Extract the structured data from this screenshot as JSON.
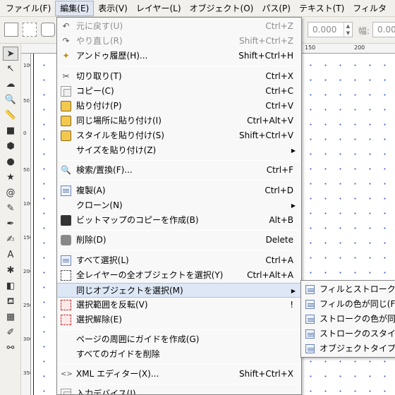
{
  "menubar": {
    "items": [
      {
        "label": "ファイル(F)"
      },
      {
        "label": "編集(E)"
      },
      {
        "label": "表示(V)"
      },
      {
        "label": "レイヤー(L)"
      },
      {
        "label": "オブジェクト(O)"
      },
      {
        "label": "パス(P)"
      },
      {
        "label": "テキスト(T)"
      },
      {
        "label": "フィルタ"
      }
    ]
  },
  "toolbar": {
    "x_value": "0.000",
    "w_label": "幅:",
    "w_value": "0.00"
  },
  "ruler": {
    "top_ticks": [
      "150",
      "200"
    ],
    "left_ticks": [
      "100",
      "50",
      "0",
      "50",
      "100",
      "150",
      "200",
      "250",
      "300",
      "350"
    ]
  },
  "edit_menu": {
    "undo": {
      "label": "元に戻す(U)",
      "shortcut": "Ctrl+Z"
    },
    "redo": {
      "label": "やり直し(R)",
      "shortcut": "Shift+Ctrl+Z"
    },
    "history": {
      "label": "アンドゥ履歴(H)...",
      "shortcut": "Shift+Ctrl+H"
    },
    "cut": {
      "label": "切り取り(T)",
      "shortcut": "Ctrl+X"
    },
    "copy": {
      "label": "コピー(C)",
      "shortcut": "Ctrl+C"
    },
    "paste": {
      "label": "貼り付け(P)",
      "shortcut": "Ctrl+V"
    },
    "paste_in_place": {
      "label": "同じ場所に貼り付け(I)",
      "shortcut": "Ctrl+Alt+V"
    },
    "paste_style": {
      "label": "スタイルを貼り付け(S)",
      "shortcut": "Shift+Ctrl+V"
    },
    "paste_size": {
      "label": "サイズを貼り付け(Z)"
    },
    "find_replace": {
      "label": "検索/置換(F)...",
      "shortcut": "Ctrl+F"
    },
    "duplicate": {
      "label": "複製(A)",
      "shortcut": "Ctrl+D"
    },
    "clone": {
      "label": "クローン(N)"
    },
    "make_bitmap": {
      "label": "ビットマップのコピーを作成(B)",
      "shortcut": "Alt+B"
    },
    "delete": {
      "label": "削除(D)",
      "shortcut": "Delete"
    },
    "select_all": {
      "label": "すべて選択(L)",
      "shortcut": "Ctrl+A"
    },
    "select_all_layers": {
      "label": "全レイヤーの全オブジェクトを選択(Y)",
      "shortcut": "Ctrl+Alt+A"
    },
    "select_same": {
      "label": "同じオブジェクトを選択(M)"
    },
    "invert_selection": {
      "label": "選択範囲を反転(V)",
      "shortcut": "!"
    },
    "deselect": {
      "label": "選択解除(E)"
    },
    "guides_around_page": {
      "label": "ページの周囲にガイドを作成(G)"
    },
    "delete_all_guides": {
      "label": "すべてのガイドを削除"
    },
    "xml_editor": {
      "label": "XML エディター(X)...",
      "shortcut": "Shift+Ctrl+X"
    },
    "input_devices": {
      "label": "入力デバイス(I)..."
    }
  },
  "submenu": {
    "items": [
      {
        "label": "フィルとストローク"
      },
      {
        "label": "フィルの色が同じ(F"
      },
      {
        "label": "ストロークの色が同"
      },
      {
        "label": "ストロークのスタイ"
      },
      {
        "label": "オブジェクトタイプ"
      }
    ]
  }
}
